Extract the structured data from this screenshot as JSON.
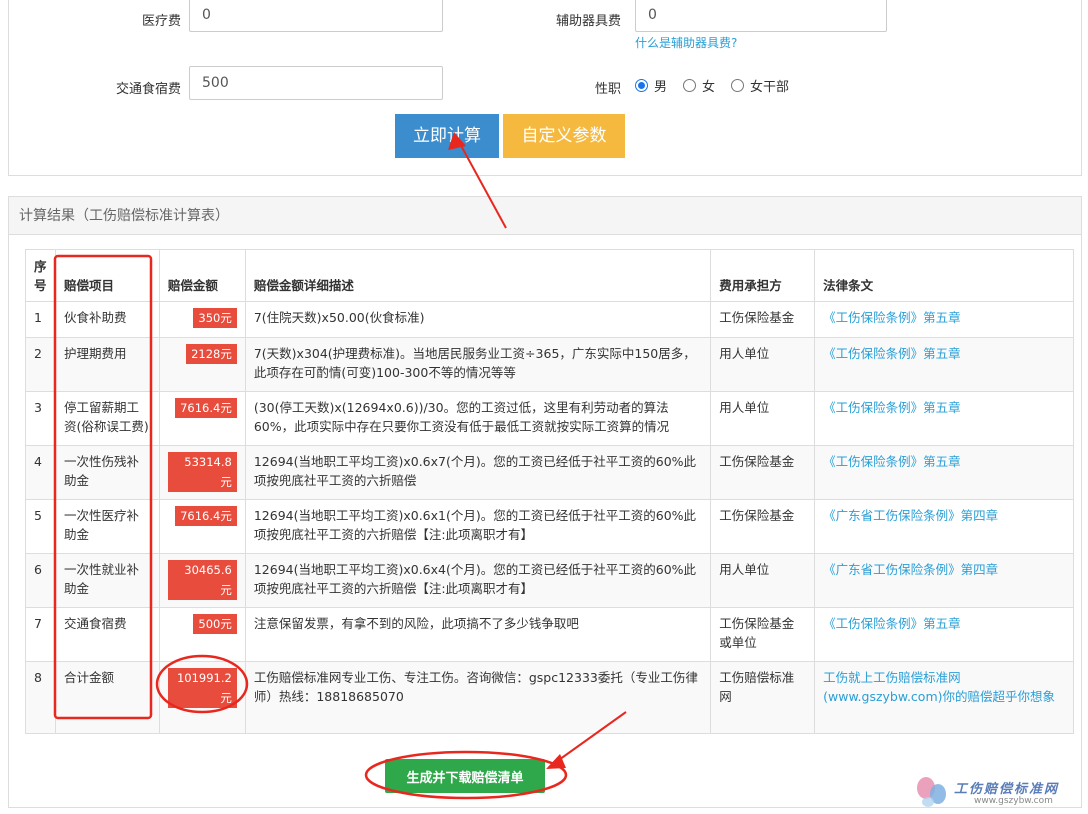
{
  "form": {
    "medical_label": "医疗费",
    "medical_value": "0",
    "assist_label": "辅助器具费",
    "assist_value": "0",
    "assist_help": "什么是辅助器具费?",
    "transport_label": "交通食宿费",
    "transport_value": "500",
    "job_label": "性职",
    "job_options": [
      "男",
      "女",
      "女干部"
    ],
    "calc_button": "立即计算",
    "custom_button": "自定义参数"
  },
  "result": {
    "title": "计算结果（工伤赔偿标准计算表）",
    "headers": [
      "序号",
      "赔偿项目",
      "赔偿金额",
      "赔偿金额详细描述",
      "费用承担方",
      "法律条文"
    ],
    "rows": [
      {
        "no": "1",
        "item": "伙食补助费",
        "amount": "350元",
        "desc": "7(住院天数)x50.00(伙食标准)",
        "payer": "工伤保险基金",
        "law": "《工伤保险条例》第五章"
      },
      {
        "no": "2",
        "item": "护理期费用",
        "amount": "2128元",
        "desc": "7(天数)x304(护理费标准)。当地居民服务业工资÷365，广东实际中150居多，此项存在可酌情(可变)100-300不等的情况等等",
        "payer": "用人单位",
        "law": "《工伤保险条例》第五章"
      },
      {
        "no": "3",
        "item": "停工留薪期工资(俗称误工费)",
        "amount": "7616.4元",
        "desc": "(30(停工天数)x(12694x0.6))/30。您的工资过低，这里有利劳动者的算法60%，此项实际中存在只要你工资没有低于最低工资就按实际工资算的情况",
        "payer": "用人单位",
        "law": "《工伤保险条例》第五章"
      },
      {
        "no": "4",
        "item": "一次性伤残补助金",
        "amount": "53314.8元",
        "desc": "12694(当地职工平均工资)x0.6x7(个月)。您的工资已经低于社平工资的60%此项按兜底社平工资的六折赔偿",
        "payer": "工伤保险基金",
        "law": "《工伤保险条例》第五章"
      },
      {
        "no": "5",
        "item": "一次性医疗补助金",
        "amount": "7616.4元",
        "desc": "12694(当地职工平均工资)x0.6x1(个月)。您的工资已经低于社平工资的60%此项按兜底社平工资的六折赔偿【注:此项离职才有】",
        "payer": "工伤保险基金",
        "law": "《广东省工伤保险条例》第四章"
      },
      {
        "no": "6",
        "item": "一次性就业补助金",
        "amount": "30465.6元",
        "desc": "12694(当地职工平均工资)x0.6x4(个月)。您的工资已经低于社平工资的60%此项按兜底社平工资的六折赔偿【注:此项离职才有】",
        "payer": "用人单位",
        "law": "《广东省工伤保险条例》第四章"
      },
      {
        "no": "7",
        "item": "交通食宿费",
        "amount": "500元",
        "desc": "注意保留发票，有拿不到的风险，此项搞不了多少钱争取吧",
        "payer": "工伤保险基金或单位",
        "law": "《工伤保险条例》第五章"
      },
      {
        "no": "8",
        "item": "合计金额",
        "amount": "101991.2元",
        "desc": "工伤赔偿标准网专业工伤、专注工伤。咨询微信：gspc12333委托（专业工伤律师）热线：18818685070",
        "payer": "工伤赔偿标准网",
        "law": "工伤就上工伤赔偿标准网(www.gszybw.com)你的赔偿超乎你想象"
      }
    ],
    "generate_button": "生成并下载赔偿清单"
  },
  "watermark": {
    "title": "工伤赔偿标准网",
    "url": "www.gszybw.com"
  },
  "colors": {
    "calc_button": "#3c8dcd",
    "custom_button": "#f6b93f",
    "amount_badge": "#e84c3d",
    "generate_button": "#2ea84a",
    "link": "#2a9fd6",
    "annotation": "#e8281e"
  }
}
